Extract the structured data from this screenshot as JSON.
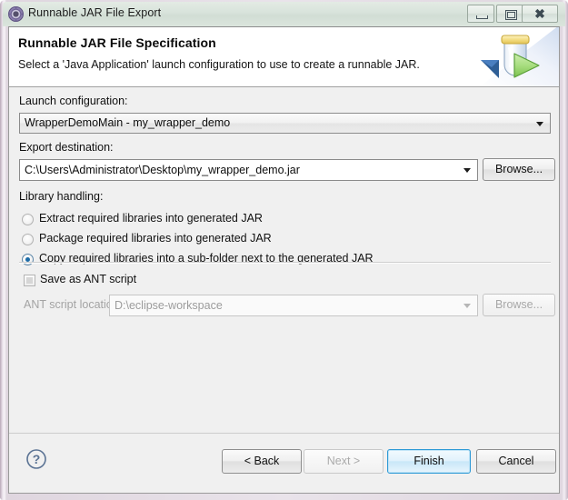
{
  "window": {
    "title": "Runnable JAR File Export",
    "icon": "export-jar-icon",
    "controls": {
      "minimize": "minimize-icon",
      "restore": "restore-icon",
      "close": "close-icon"
    }
  },
  "banner": {
    "title": "Runnable JAR File Specification",
    "description": "Select a 'Java Application' launch configuration to use to create a runnable JAR.",
    "art": "jar-export-banner-icon"
  },
  "form": {
    "launch_configuration": {
      "label": "Launch configuration:",
      "value": "WrapperDemoMain - my_wrapper_demo"
    },
    "export_destination": {
      "label": "Export destination:",
      "value": "C:\\Users\\Administrator\\Desktop\\my_wrapper_demo.jar",
      "browse_label": "Browse..."
    },
    "library_handling": {
      "label": "Library handling:",
      "options": [
        {
          "label": "Extract required libraries into generated JAR",
          "selected": false
        },
        {
          "label": "Package required libraries into generated JAR",
          "selected": false
        },
        {
          "label": "Copy required libraries into a sub-folder next to the generated JAR",
          "selected": true
        }
      ]
    },
    "ant_script": {
      "checkbox_label": "Save as ANT script",
      "checked": false,
      "location_label": "ANT script location:",
      "location_value": "D:\\eclipse-workspace",
      "browse_label": "Browse...",
      "enabled": false
    }
  },
  "buttons": {
    "help": "?",
    "back": "< Back",
    "next": "Next >",
    "finish": "Finish",
    "cancel": "Cancel"
  },
  "colors": {
    "titlebar": "#d8e3db",
    "body": "#f0f0f0",
    "banner": "#ffffff",
    "accent_default_button": "#2f9ad6",
    "radio_selected": "#1c6ca8",
    "disabled_text": "#a3a3a3"
  }
}
